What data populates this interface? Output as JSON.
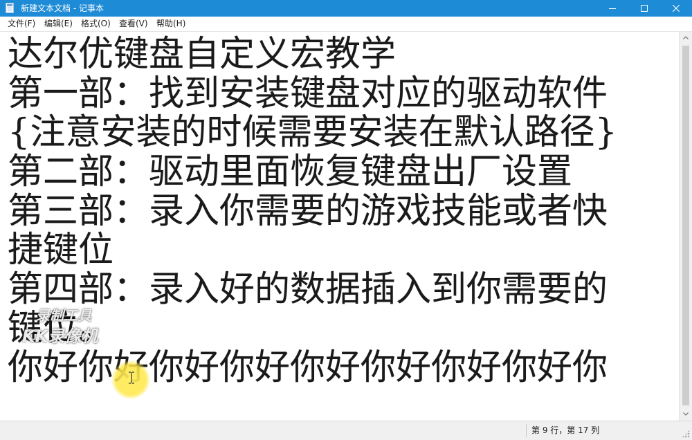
{
  "window": {
    "title": "新建文本文档 - 记事本"
  },
  "menu": [
    {
      "label": "文件(F)"
    },
    {
      "label": "编辑(E)"
    },
    {
      "label": "格式(O)"
    },
    {
      "label": "查看(V)"
    },
    {
      "label": "帮助(H)"
    }
  ],
  "editor": {
    "lines": [
      "达尔优键盘自定义宏教学",
      "第一部：找到安装键盘对应的驱动软件",
      "{注意安装的时候需要安装在默认路径}",
      "第二部：驱动里面恢复键盘出厂设置",
      "第三部：录入你需要的游戏技能或者快",
      "捷键位",
      "第四部：录入好的数据插入到你需要的",
      "键位。",
      "你好你好你好你好你好你好你好你好你"
    ]
  },
  "status": {
    "position": "第 9 行，第 17 列"
  },
  "watermark": {
    "line1": "录制工具",
    "line2": "KK录像机"
  },
  "icons": {
    "app": "notepad-icon",
    "minimize": "minimize-icon",
    "maximize": "maximize-icon",
    "close": "close-icon",
    "cursor": "text-cursor-icon"
  },
  "colors": {
    "titlebar": "#1e8bd6",
    "cursor_highlight": "#ffe84a"
  }
}
